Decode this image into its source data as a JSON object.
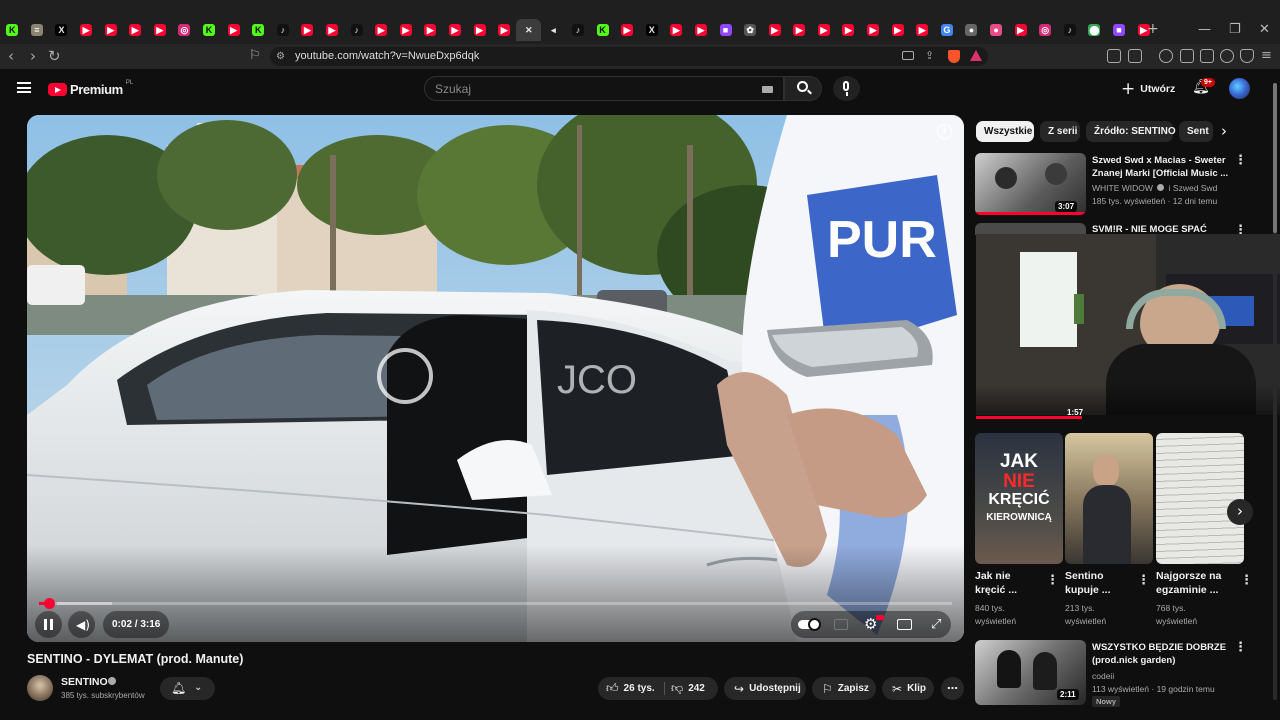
{
  "browser": {
    "tabs": [
      {
        "icon": "kick-icon",
        "color": "#53fc18",
        "glyph": "K"
      },
      {
        "icon": "notes-icon",
        "color": "#8a8470",
        "glyph": "≡"
      },
      {
        "icon": "x-icon",
        "color": "#000000",
        "glyph": "X"
      },
      {
        "icon": "youtube-icon",
        "color": "#ff0033",
        "glyph": "▶"
      },
      {
        "icon": "youtube-icon",
        "color": "#ff0033",
        "glyph": "▶"
      },
      {
        "icon": "youtube-icon",
        "color": "#ff0033",
        "glyph": "▶"
      },
      {
        "icon": "youtube-icon",
        "color": "#ff0033",
        "glyph": "▶"
      },
      {
        "icon": "instagram-icon",
        "color": "#d62976",
        "glyph": "◎"
      },
      {
        "icon": "kick-icon",
        "color": "#53fc18",
        "glyph": "K"
      },
      {
        "icon": "youtube-icon",
        "color": "#ff0033",
        "glyph": "▶"
      },
      {
        "icon": "kick-icon",
        "color": "#53fc18",
        "glyph": "K"
      },
      {
        "icon": "tiktok-icon",
        "color": "#111111",
        "glyph": "♪"
      },
      {
        "icon": "youtube-icon",
        "color": "#ff0033",
        "glyph": "▶"
      },
      {
        "icon": "youtube-icon",
        "color": "#ff0033",
        "glyph": "▶"
      },
      {
        "icon": "tiktok-icon",
        "color": "#111111",
        "glyph": "♪"
      },
      {
        "icon": "youtube-icon",
        "color": "#ff0033",
        "glyph": "▶"
      },
      {
        "icon": "youtube-icon",
        "color": "#ff0033",
        "glyph": "▶"
      },
      {
        "icon": "youtube-icon",
        "color": "#ff0033",
        "glyph": "▶"
      },
      {
        "icon": "youtube-icon",
        "color": "#ff0033",
        "glyph": "▶"
      },
      {
        "icon": "youtube-icon",
        "color": "#ff0033",
        "glyph": "▶"
      },
      {
        "icon": "youtube-icon",
        "color": "#ff0033",
        "glyph": "▶"
      },
      {
        "icon": "tab-close-icon",
        "color": "#3c3c3c",
        "glyph": "✕"
      },
      {
        "icon": "speaker-icon",
        "color": "#1f1f1f",
        "glyph": "◂"
      },
      {
        "icon": "tiktok-icon",
        "color": "#111111",
        "glyph": "♪"
      },
      {
        "icon": "kick-icon",
        "color": "#53fc18",
        "glyph": "K"
      },
      {
        "icon": "youtube-icon",
        "color": "#ff0033",
        "glyph": "▶"
      },
      {
        "icon": "x-icon",
        "color": "#000000",
        "glyph": "X"
      },
      {
        "icon": "youtube-icon",
        "color": "#ff0033",
        "glyph": "▶"
      },
      {
        "icon": "youtube-icon",
        "color": "#ff0033",
        "glyph": "▶"
      },
      {
        "icon": "twitch-icon",
        "color": "#9146ff",
        "glyph": "■"
      },
      {
        "icon": "chatgpt-icon",
        "color": "#555555",
        "glyph": "✿"
      },
      {
        "icon": "youtube-icon",
        "color": "#ff0033",
        "glyph": "▶"
      },
      {
        "icon": "youtube-icon",
        "color": "#ff0033",
        "glyph": "▶"
      },
      {
        "icon": "youtube-icon",
        "color": "#ff0033",
        "glyph": "▶"
      },
      {
        "icon": "youtube-icon",
        "color": "#ff0033",
        "glyph": "▶"
      },
      {
        "icon": "youtube-icon",
        "color": "#ff0033",
        "glyph": "▶"
      },
      {
        "icon": "youtube-icon",
        "color": "#ff0033",
        "glyph": "▶"
      },
      {
        "icon": "youtube-icon",
        "color": "#ff0033",
        "glyph": "▶"
      },
      {
        "icon": "google-icon",
        "color": "#4285f4",
        "glyph": "G"
      },
      {
        "icon": "globe-icon",
        "color": "#666666",
        "glyph": "●"
      },
      {
        "icon": "app-icon",
        "color": "#e84c88",
        "glyph": "●"
      },
      {
        "icon": "youtube-icon",
        "color": "#ff0033",
        "glyph": "▶"
      },
      {
        "icon": "instagram-icon",
        "color": "#d62976",
        "glyph": "◎"
      },
      {
        "icon": "tiktok-icon",
        "color": "#111111",
        "glyph": "♪"
      },
      {
        "icon": "maps-icon",
        "color": "#34a853",
        "glyph": "⬤"
      },
      {
        "icon": "twitch-icon",
        "color": "#9146ff",
        "glyph": "■"
      },
      {
        "icon": "youtube-icon",
        "color": "#ff0033",
        "glyph": "▶"
      }
    ],
    "new_tab": "+",
    "url": "youtube.com/watch?v=NwueDxp6dqk"
  },
  "yt": {
    "logo_text": "Premium",
    "logo_badge": "PL",
    "search_placeholder": "Szukaj",
    "create_label": "Utwórz",
    "notif_count": "9+"
  },
  "player": {
    "time": "0:02 / 3:16",
    "progress_fraction": 0.011,
    "overlay_text": "PUR",
    "watermark_text": "JCO"
  },
  "video": {
    "title": "SENTINO - DYLEMAT (prod. Manute)",
    "channel": "SENTINO",
    "subscribers": "385 tys. subskrybentów",
    "likes": "26 tys.",
    "dislikes": "242",
    "share": "Udostępnij",
    "save": "Zapisz",
    "clip": "Klip",
    "more": "…"
  },
  "sidebar": {
    "chips": [
      "Wszystkie",
      "Z serii",
      "Źródło: SENTINO",
      "Sent"
    ],
    "videos": [
      {
        "title": "Szwed Swd x Macias - Sweter Znanej Marki [Official Music ...",
        "channel": "WHITE WIDOW",
        "channel_extra": "i Szwed Swd",
        "meta": "185 tys. wyświetleń · 12 dni temu",
        "duration": "3:07"
      },
      {
        "title": "SVM!R - NIE MOGE SPAĆ",
        "duration": "1:57"
      }
    ],
    "shorts": [
      {
        "thumb_line1": "JAK",
        "thumb_line2": "NIE",
        "thumb_line3": "KRĘCIĆ",
        "thumb_line4": "KIEROWNICĄ",
        "title1": "Jak nie",
        "title2": "kręcić ...",
        "views1": "840 tys.",
        "views2": "wyświetleń"
      },
      {
        "title1": "Sentino",
        "title2": "kupuje ...",
        "views1": "213 tys.",
        "views2": "wyświetleń"
      },
      {
        "title1": "Najgorsze na",
        "title2": "egzaminie ...",
        "views1": "768 tys.",
        "views2": "wyświetleń"
      }
    ],
    "last_video": {
      "title1": "WSZYSTKO BĘDZIE DOBRZE",
      "title2": "(prod.nick garden)",
      "channel": "codeii",
      "meta": "113 wyświetleń · 19 godzin temu",
      "badge": "Nowy",
      "duration": "2:11"
    }
  }
}
